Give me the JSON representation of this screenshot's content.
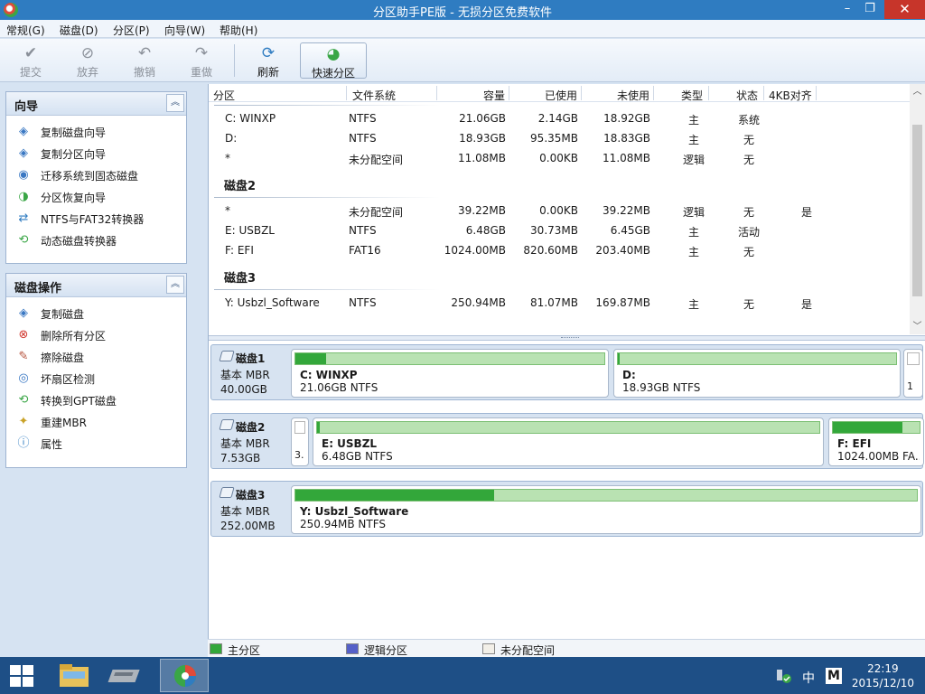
{
  "window": {
    "title": "分区助手PE版 - 无损分区免费软件",
    "minimize_glyph": "–",
    "maximize_glyph": "❐",
    "close_glyph": "✕"
  },
  "menu": [
    "常规(G)",
    "磁盘(D)",
    "分区(P)",
    "向导(W)",
    "帮助(H)"
  ],
  "toolbar": {
    "commit": "提交",
    "discard": "放弃",
    "undo": "撤销",
    "redo": "重做",
    "refresh": "刷新",
    "quick_partition": "快速分区"
  },
  "wizard_panel": {
    "title": "向导",
    "collapse_glyph": "︽",
    "items": [
      "复制磁盘向导",
      "复制分区向导",
      "迁移系统到固态磁盘",
      "分区恢复向导",
      "NTFS与FAT32转换器",
      "动态磁盘转换器"
    ]
  },
  "disk_ops_panel": {
    "title": "磁盘操作",
    "collapse_glyph": "︽",
    "items": [
      "复制磁盘",
      "删除所有分区",
      "擦除磁盘",
      "坏扇区检测",
      "转换到GPT磁盘",
      "重建MBR",
      "属性"
    ]
  },
  "columns": [
    "分区",
    "文件系统",
    "容量",
    "已使用",
    "未使用",
    "类型",
    "状态",
    "4KB对齐"
  ],
  "disk_list": [
    {
      "group": "",
      "rows": [
        {
          "partition": "C: WINXP",
          "fs": "NTFS",
          "capacity": "21.06GB",
          "used": "2.14GB",
          "free": "18.92GB",
          "type": "主",
          "status": "系统",
          "align": ""
        },
        {
          "partition": "D:",
          "fs": "NTFS",
          "capacity": "18.93GB",
          "used": "95.35MB",
          "free": "18.83GB",
          "type": "主",
          "status": "无",
          "align": ""
        },
        {
          "partition": "*",
          "fs": "未分配空间",
          "capacity": "11.08MB",
          "used": "0.00KB",
          "free": "11.08MB",
          "type": "逻辑",
          "status": "无",
          "align": ""
        }
      ]
    },
    {
      "group": "磁盘2",
      "rows": [
        {
          "partition": "*",
          "fs": "未分配空间",
          "capacity": "39.22MB",
          "used": "0.00KB",
          "free": "39.22MB",
          "type": "逻辑",
          "status": "无",
          "align": "是"
        },
        {
          "partition": "E: USBZL",
          "fs": "NTFS",
          "capacity": "6.48GB",
          "used": "30.73MB",
          "free": "6.45GB",
          "type": "主",
          "status": "活动",
          "align": ""
        },
        {
          "partition": "F: EFI",
          "fs": "FAT16",
          "capacity": "1024.00MB",
          "used": "820.60MB",
          "free": "203.40MB",
          "type": "主",
          "status": "无",
          "align": ""
        }
      ]
    },
    {
      "group": "磁盘3",
      "rows": [
        {
          "partition": "Y: Usbzl_Software",
          "fs": "NTFS",
          "capacity": "250.94MB",
          "used": "81.07MB",
          "free": "169.87MB",
          "type": "主",
          "status": "无",
          "align": "是"
        }
      ]
    }
  ],
  "disk_map": [
    {
      "name": "磁盘1",
      "type": "基本 MBR",
      "size": "40.00GB",
      "partitions": [
        {
          "name": "C: WINXP",
          "desc": "21.06GB NTFS",
          "used_fraction": 0.1
        },
        {
          "name": "D:",
          "desc": "18.93GB NTFS",
          "used_fraction": 0.005
        },
        {
          "name": "",
          "desc": "1",
          "used_fraction": 0
        }
      ]
    },
    {
      "name": "磁盘2",
      "type": "基本 MBR",
      "size": "7.53GB",
      "partitions": [
        {
          "name": "",
          "desc": "3.",
          "used_fraction": 0
        },
        {
          "name": "E: USBZL",
          "desc": "6.48GB NTFS",
          "used_fraction": 0.005
        },
        {
          "name": "F: EFI",
          "desc": "1024.00MB FA...",
          "used_fraction": 0.8
        }
      ]
    },
    {
      "name": "磁盘3",
      "type": "基本 MBR",
      "size": "252.00MB",
      "partitions": [
        {
          "name": "Y: Usbzl_Software",
          "desc": "250.94MB NTFS",
          "used_fraction": 0.32
        }
      ]
    }
  ],
  "legend": [
    "主分区",
    "逻辑分区",
    "未分配空间"
  ],
  "colors": {
    "primary": "#33a73a",
    "logical": "#5560c8",
    "unallocated": "#f2efe8",
    "titlebar": "#2f7cc1",
    "taskbar": "#1e4f86"
  },
  "taskbar": {
    "ime": "中",
    "ime_mode": "M",
    "time": "22:19",
    "date": "2015/12/10"
  }
}
